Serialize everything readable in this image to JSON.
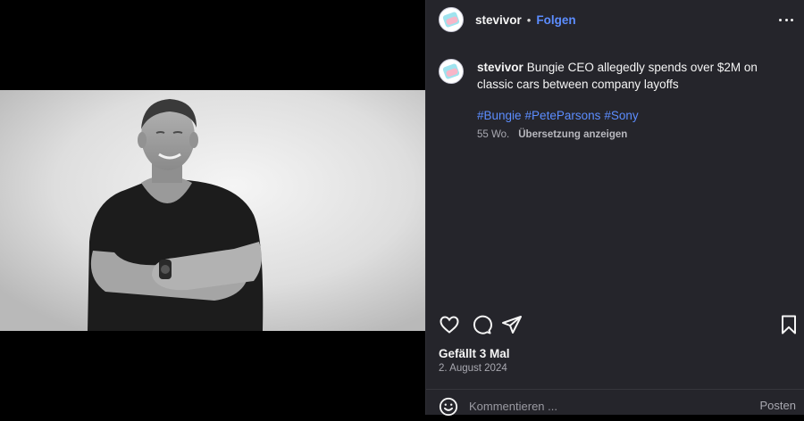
{
  "post": {
    "username": "stevivor",
    "separator": "•",
    "follow_label": "Folgen",
    "caption": "Bungie CEO allegedly spends over $2M on classic cars between company layoffs",
    "hashtags": [
      "#Bungie",
      "#PeteParsons",
      "#Sony"
    ],
    "age": "55 Wo.",
    "translate_label": "Übersetzung anzeigen",
    "likes": "Gefällt 3 Mal",
    "date": "2. August 2024"
  },
  "comment": {
    "placeholder": "Kommentieren ...",
    "post_label": "Posten"
  },
  "icons": {
    "more": "more-horizontal-icon",
    "like": "heart-icon",
    "comment": "comment-bubble-icon",
    "share": "paper-plane-icon",
    "save": "bookmark-icon",
    "emoji": "emoji-smile-icon"
  },
  "colors": {
    "panel_bg": "#25252b",
    "link": "#5c8dff",
    "muted": "#a8a8b0"
  }
}
